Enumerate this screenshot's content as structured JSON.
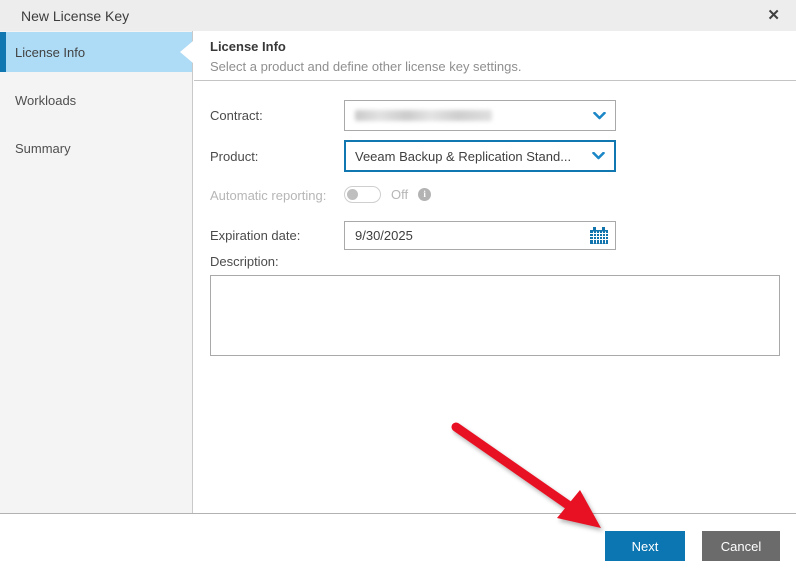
{
  "window": {
    "title": "New License Key"
  },
  "icons": {
    "close": "✕",
    "info": "i"
  },
  "sidebar": {
    "steps": [
      {
        "label": "License Info",
        "active": true
      },
      {
        "label": "Workloads",
        "active": false
      },
      {
        "label": "Summary",
        "active": false
      }
    ]
  },
  "header": {
    "title": "License Info",
    "subtitle": "Select a product and define other license key settings."
  },
  "form": {
    "contract_label": "Contract:",
    "contract_value_redacted": true,
    "product_label": "Product:",
    "product_value": "Veeam Backup & Replication Stand...",
    "reporting_label": "Automatic reporting:",
    "reporting_state": "Off",
    "expiration_label": "Expiration date:",
    "expiration_value": "9/30/2025",
    "description_label": "Description:",
    "description_value": ""
  },
  "footer": {
    "next": "Next",
    "cancel": "Cancel"
  },
  "annotation": {
    "type": "red-arrow",
    "target": "next-button"
  },
  "colors": {
    "accent_blue": "#1177b0",
    "chevron_blue": "#1b87c6",
    "active_step_bg": "#aedbf5",
    "next_button": "#0b76b1",
    "cancel_button": "#6b6b6b",
    "arrow_red": "#e81123",
    "titlebar_bg": "#ededed"
  }
}
